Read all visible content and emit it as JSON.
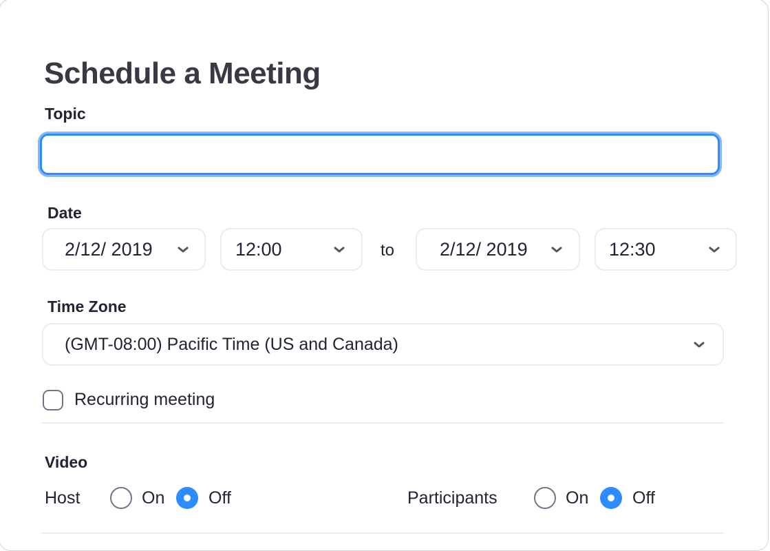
{
  "page": {
    "title": "Schedule a Meeting"
  },
  "topic": {
    "label": "Topic",
    "value": "",
    "placeholder": ""
  },
  "date": {
    "label": "Date",
    "start_date": "2/12/ 2019",
    "start_time": "12:00",
    "separator": "to",
    "end_date": "2/12/ 2019",
    "end_time": "12:30"
  },
  "time_zone": {
    "label": "Time Zone",
    "value": "(GMT-08:00) Pacific Time (US and Canada)"
  },
  "recurring": {
    "label": "Recurring meeting",
    "checked": false
  },
  "video": {
    "label": "Video",
    "host": {
      "label": "Host",
      "options": [
        "On",
        "Off"
      ],
      "selected": "Off"
    },
    "participants": {
      "label": "Participants",
      "options": [
        "On",
        "Off"
      ],
      "selected": "Off"
    }
  },
  "colors": {
    "accent": "#2d8cff",
    "text": "#232333",
    "title": "#393945",
    "border": "#ececf0"
  },
  "icons": {
    "dropdown": "chevron-down-icon"
  }
}
